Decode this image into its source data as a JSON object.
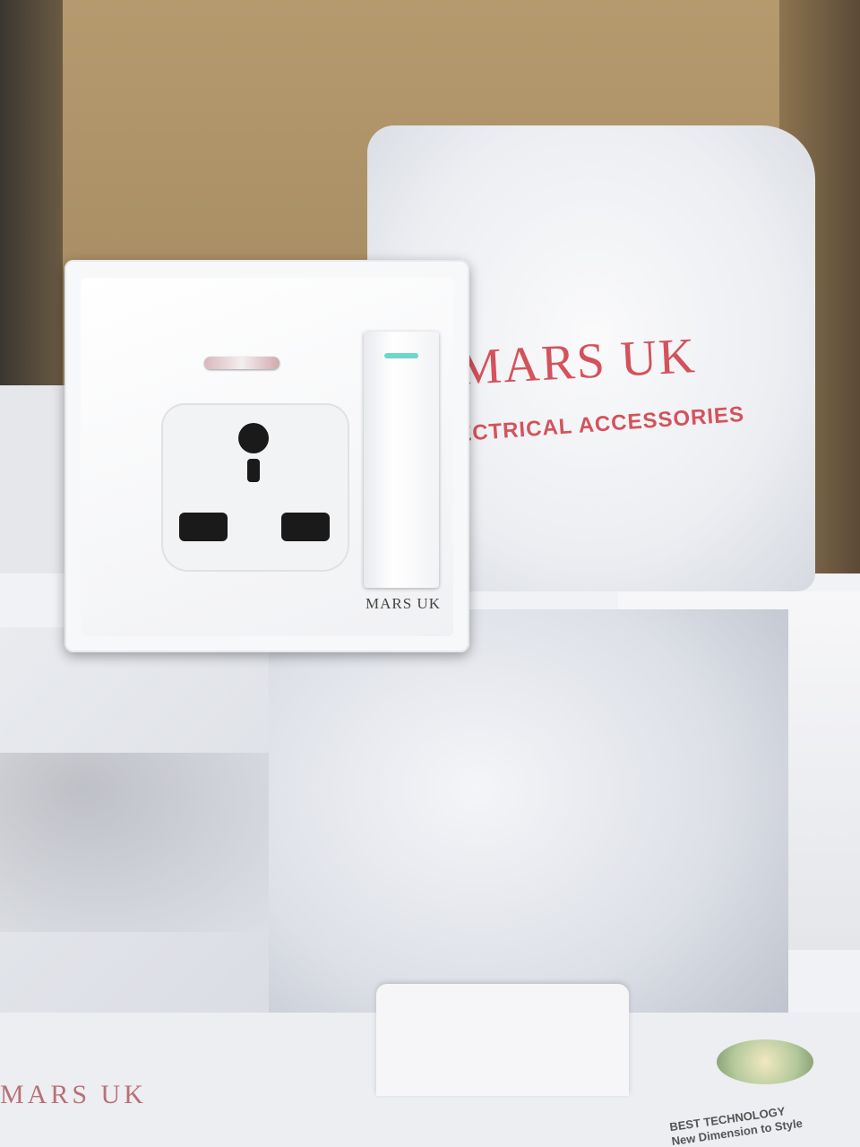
{
  "bag": {
    "brand": "MARS UK",
    "subtitle": "ECTRICAL ACCESSORIES"
  },
  "socket": {
    "brand": "MARS UK"
  },
  "box": {
    "front_brand": "MARS UK",
    "tagline_line1": "BEST TECHNOLOGY",
    "tagline_line2": "New Dimension to Style"
  },
  "colors": {
    "brand_red": "#d4525c",
    "indicator_led": "#6fd6cc",
    "box_red": "#d8262c"
  }
}
